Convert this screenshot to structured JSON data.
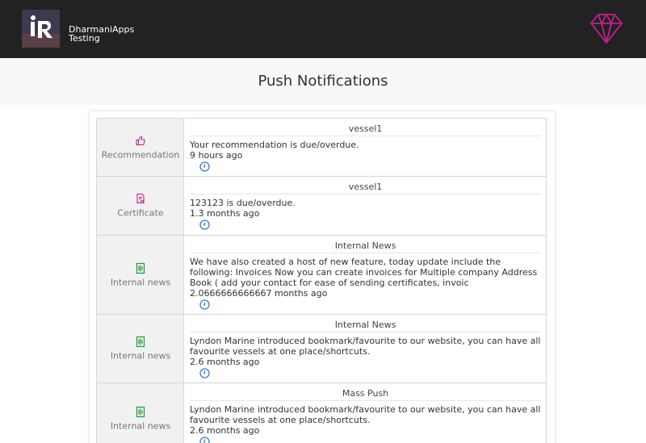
{
  "header": {
    "brand_line1": "DharmaniApps",
    "brand_line2": "Testing",
    "logo_icon": "brand-logo-icon",
    "premium_icon": "diamond-icon",
    "accent_color": "#c2208c"
  },
  "page": {
    "title": "Push Notifications"
  },
  "notifications": [
    {
      "category": "Recommendation",
      "icon": "thumbs-up-icon",
      "title": "vessel1",
      "body": "Your recommendation is due/overdue.",
      "time": "9 hours ago"
    },
    {
      "category": "Certificate",
      "icon": "certificate-icon",
      "title": "vessel1",
      "body": "123123 is due/overdue.",
      "time": "1.3 months ago"
    },
    {
      "category": "Internal news",
      "icon": "news-icon",
      "title": "Internal News",
      "body": "We have also created a host of new feature, today update include the following: Invoices Now you can create invoices for Multiple company  Address Book ( add your contact for ease of sending certificates, invoic",
      "time": "2.0666666666667 months ago"
    },
    {
      "category": "Internal news",
      "icon": "news-icon",
      "title": "Internal News",
      "body": "Lyndon Marine introduced bookmark/favourite to our website, you can have all favourite vessels at one place/shortcuts.",
      "time": "2.6 months ago"
    },
    {
      "category": "Internal news",
      "icon": "news-icon",
      "title": "Mass Push",
      "body": "Lyndon Marine introduced bookmark/favourite to our website, you can have all favourite vessels at one place/shortcuts.",
      "time": "2.6 months ago"
    }
  ]
}
